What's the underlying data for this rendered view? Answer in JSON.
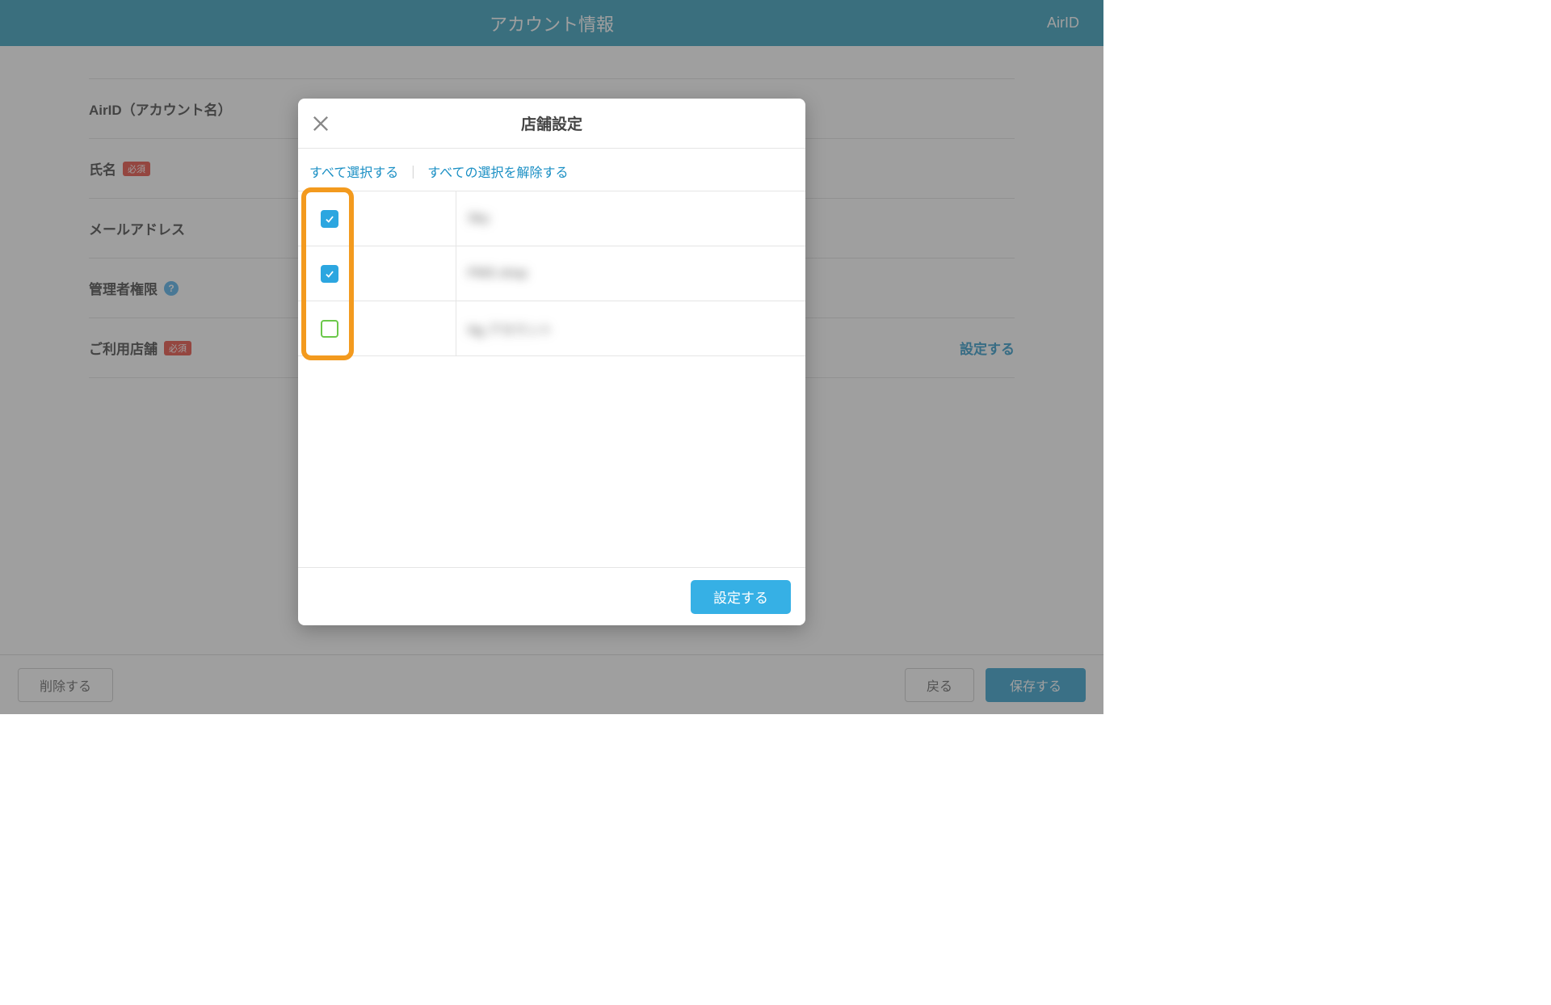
{
  "header": {
    "title": "アカウント情報",
    "right": "AirID"
  },
  "form": {
    "airid_label": "AirID（アカウント名）",
    "name_label": "氏名",
    "email_label": "メールアドレス",
    "admin_label": "管理者権限",
    "stores_label": "ご利用店舗",
    "required_badge": "必須",
    "configure_link": "設定する"
  },
  "footer": {
    "delete": "削除する",
    "back": "戻る",
    "save": "保存する"
  },
  "modal": {
    "title": "店舗設定",
    "select_all": "すべて選択する",
    "deselect_all": "すべての選択を解除する",
    "confirm": "設定する",
    "rows": [
      {
        "checked": true,
        "name": "Sky"
      },
      {
        "checked": true,
        "name": "PMS shop"
      },
      {
        "checked": false,
        "name": "Ng アカウント"
      }
    ]
  }
}
